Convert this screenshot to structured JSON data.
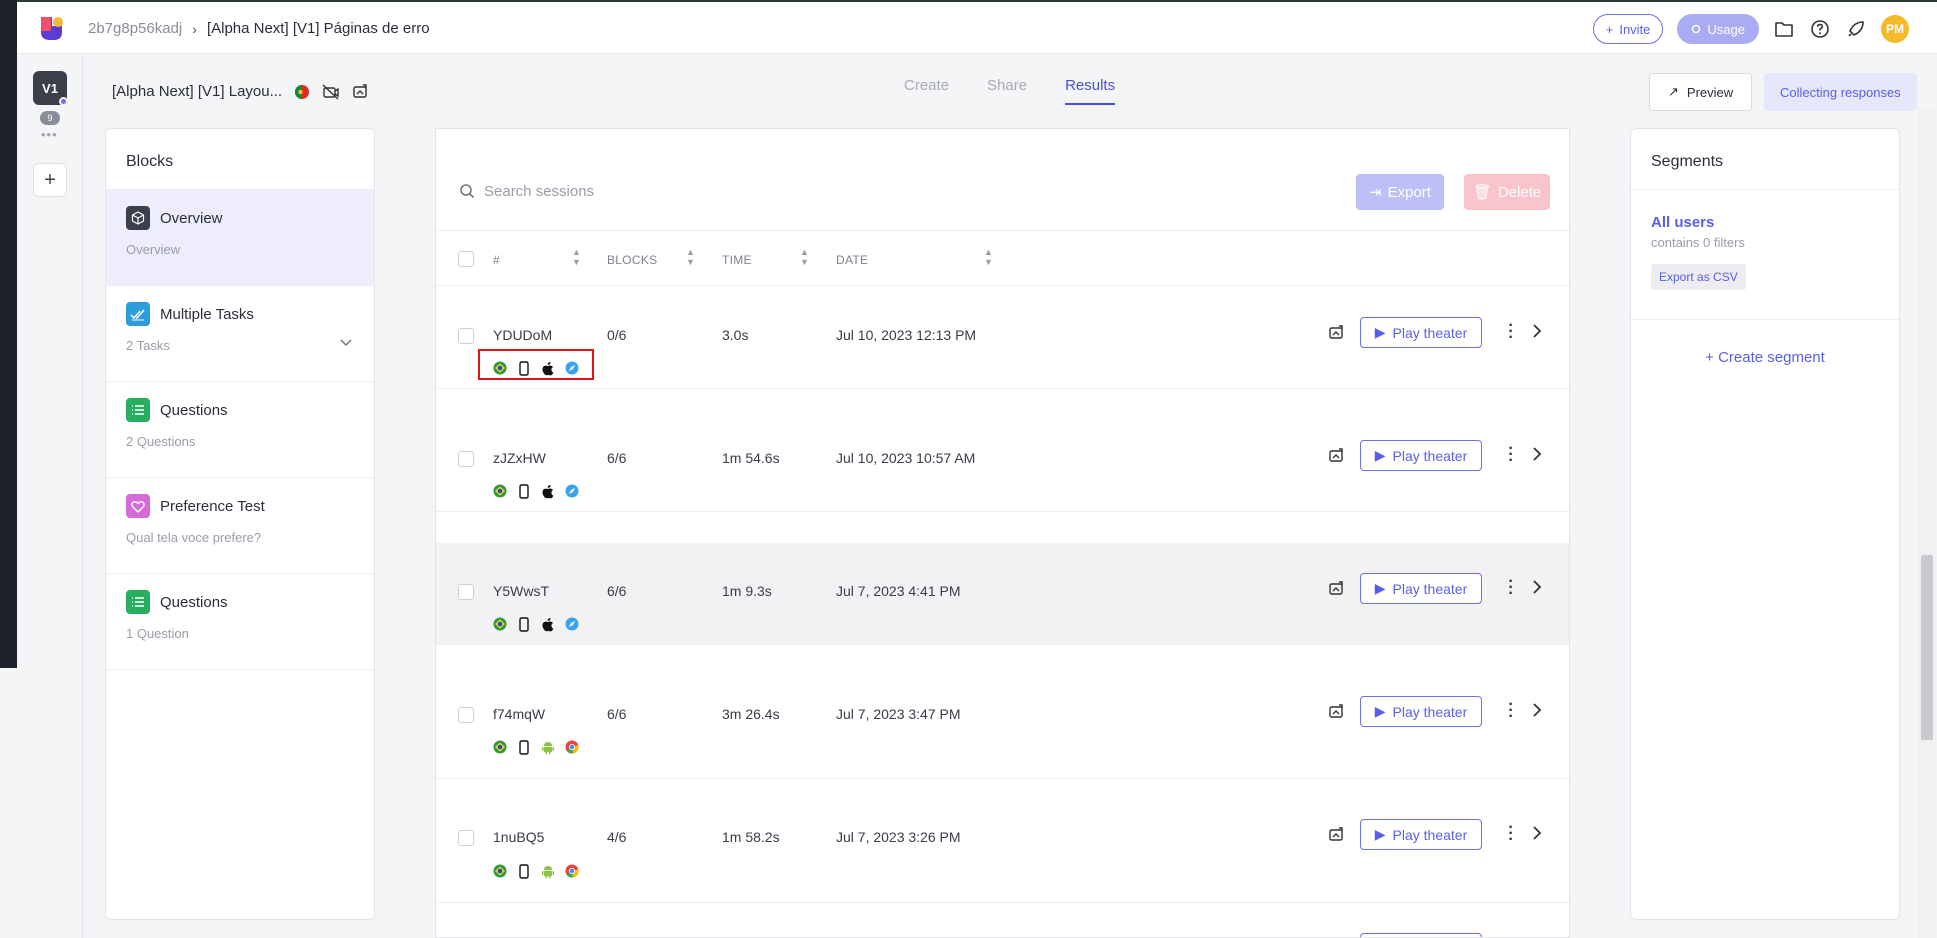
{
  "header": {
    "project_id": "2b7g8p56kadj",
    "study_title": "[Alpha Next] [V1] Páginas de erro",
    "invite_label": "Invite",
    "usage_label": "Usage",
    "avatar_initials": "PM"
  },
  "rail": {
    "version_label": "V1",
    "version_count": "9",
    "dots": "•••",
    "add_label": "+"
  },
  "subheader": {
    "study_name": "[Alpha Next] [V1] Layou...",
    "tabs": [
      "Create",
      "Share",
      "Results"
    ],
    "active_tab": "Results",
    "preview_label": "Preview",
    "status_label": "Collecting responses"
  },
  "blocks": {
    "title": "Blocks",
    "items": [
      {
        "title": "Overview",
        "subtitle": "Overview",
        "icon": "cube-icon",
        "color": "#3b3f4c"
      },
      {
        "title": "Multiple Tasks",
        "subtitle": "2 Tasks",
        "icon": "double-check-icon",
        "color": "#2d9cdb"
      },
      {
        "title": "Questions",
        "subtitle": "2 Questions",
        "icon": "list-icon",
        "color": "#27ae60"
      },
      {
        "title": "Preference Test",
        "subtitle": "Qual tela voce prefere?",
        "icon": "heart-icon",
        "color": "#d66bd8"
      },
      {
        "title": "Questions",
        "subtitle": "1 Question",
        "icon": "list-icon",
        "color": "#27ae60"
      }
    ]
  },
  "sessions": {
    "search_placeholder": "Search sessions",
    "export_label": "Export",
    "delete_label": "Delete",
    "columns": [
      "#",
      "BLOCKS",
      "TIME",
      "DATE"
    ],
    "play_label": "Play theater",
    "rows": [
      {
        "id": "YDUDoM",
        "blocks": "0/6",
        "time": "3.0s",
        "date": "Jul 10, 2023 12:13 PM",
        "os": "apple-icon",
        "browser": "safari-icon"
      },
      {
        "id": "zJZxHW",
        "blocks": "6/6",
        "time": "1m 54.6s",
        "date": "Jul 10, 2023 10:57 AM",
        "os": "apple-icon",
        "browser": "safari-icon"
      },
      {
        "id": "Y5WwsT",
        "blocks": "6/6",
        "time": "1m 9.3s",
        "date": "Jul 7, 2023 4:41 PM",
        "os": "apple-icon",
        "browser": "safari-icon"
      },
      {
        "id": "f74mqW",
        "blocks": "6/6",
        "time": "3m 26.4s",
        "date": "Jul 7, 2023 3:47 PM",
        "os": "android-icon",
        "browser": "chrome-icon"
      },
      {
        "id": "1nuBQ5",
        "blocks": "4/6",
        "time": "1m 58.2s",
        "date": "Jul 7, 2023 3:26 PM",
        "os": "android-icon",
        "browser": "chrome-icon"
      }
    ]
  },
  "segments": {
    "title": "Segments",
    "segment_name": "All users",
    "segment_filters": "contains 0 filters",
    "export_csv_label": "Export as CSV",
    "create_label": "+ Create segment"
  },
  "colors": {
    "accent": "#5a5fe8",
    "highlight": "#e3121b"
  }
}
